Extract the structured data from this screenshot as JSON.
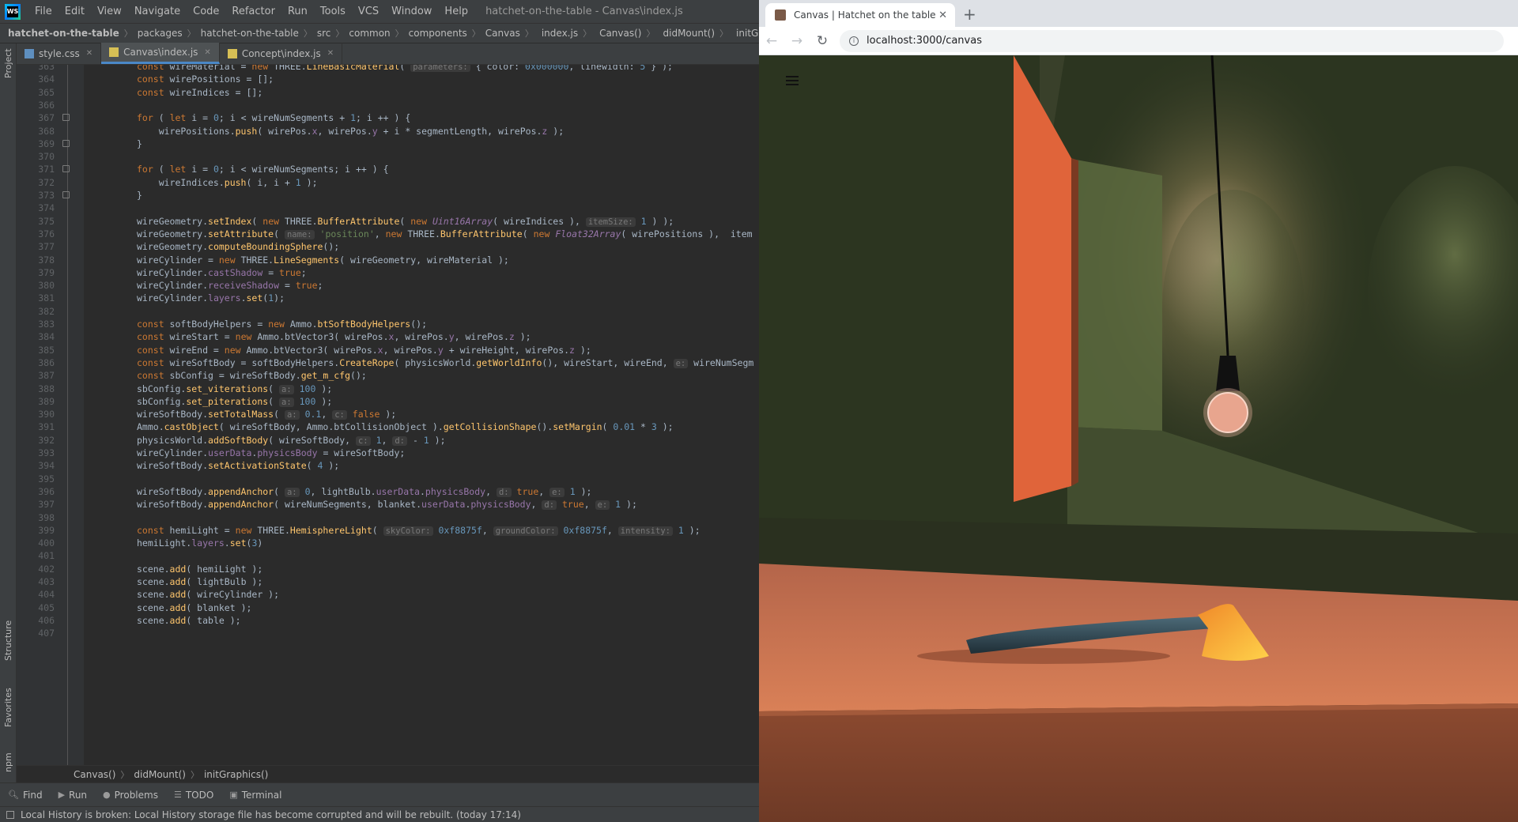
{
  "ide": {
    "logo": "WS",
    "menu": [
      "File",
      "Edit",
      "View",
      "Navigate",
      "Code",
      "Refactor",
      "Run",
      "Tools",
      "VCS",
      "Window",
      "Help"
    ],
    "window_title": "hatchet-on-the-table - Canvas\\index.js",
    "breadcrumbs": [
      "hatchet-on-the-table",
      "packages",
      "hatchet-on-the-table",
      "src",
      "common",
      "components",
      "Canvas",
      "index.js",
      "Canvas()",
      "didMount()",
      "initGraphics()"
    ],
    "left_tabs": [
      "Project",
      "Structure",
      "Favorites",
      "npm"
    ],
    "tabs": [
      {
        "label": "style.css",
        "active": false
      },
      {
        "label": "Canvas\\index.js",
        "active": true
      },
      {
        "label": "Concept\\index.js",
        "active": false
      }
    ],
    "editor_crumbs": [
      "Canvas()",
      "didMount()",
      "initGraphics()"
    ],
    "tool_windows": [
      "Find",
      "Run",
      "Problems",
      "TODO",
      "Terminal"
    ],
    "status_message": "Local History is broken: Local History storage file has become corrupted and will be rebuilt. (today 17:14)",
    "code_lines": [
      {
        "n": "363",
        "t": "const wireMaterial = new THREE.LineBasicMaterial(  parameters: { color: 0x000000, linewidth: 5 } );"
      },
      {
        "n": "364",
        "t": "const wirePositions = [];"
      },
      {
        "n": "365",
        "t": "const wireIndices = [];"
      },
      {
        "n": "366",
        "t": ""
      },
      {
        "n": "367",
        "t": "for ( let i = 0; i < wireNumSegments + 1; i ++ ) {"
      },
      {
        "n": "368",
        "t": "    wirePositions.push( wirePos.x, wirePos.y + i * segmentLength, wirePos.z );"
      },
      {
        "n": "369",
        "t": "}"
      },
      {
        "n": "370",
        "t": ""
      },
      {
        "n": "371",
        "t": "for ( let i = 0; i < wireNumSegments; i ++ ) {"
      },
      {
        "n": "372",
        "t": "    wireIndices.push( i, i + 1 );"
      },
      {
        "n": "373",
        "t": "}"
      },
      {
        "n": "374",
        "t": ""
      },
      {
        "n": "375",
        "t": "wireGeometry.setIndex( new THREE.BufferAttribute( new Uint16Array( wireIndices ),  itemSize: 1 ) );"
      },
      {
        "n": "376",
        "t": "wireGeometry.setAttribute(  name: 'position', new THREE.BufferAttribute( new Float32Array( wirePositions ),  item"
      },
      {
        "n": "377",
        "t": "wireGeometry.computeBoundingSphere();"
      },
      {
        "n": "378",
        "t": "wireCylinder = new THREE.LineSegments( wireGeometry, wireMaterial );"
      },
      {
        "n": "379",
        "t": "wireCylinder.castShadow = true;"
      },
      {
        "n": "380",
        "t": "wireCylinder.receiveShadow = true;"
      },
      {
        "n": "381",
        "t": "wireCylinder.layers.set(1);"
      },
      {
        "n": "382",
        "t": ""
      },
      {
        "n": "383",
        "t": "const softBodyHelpers = new Ammo.btSoftBodyHelpers();"
      },
      {
        "n": "384",
        "t": "const wireStart = new Ammo.btVector3( wirePos.x, wirePos.y, wirePos.z );"
      },
      {
        "n": "385",
        "t": "const wireEnd = new Ammo.btVector3( wirePos.x, wirePos.y + wireHeight, wirePos.z );"
      },
      {
        "n": "386",
        "t": "const wireSoftBody = softBodyHelpers.CreateRope( physicsWorld.getWorldInfo(), wireStart, wireEnd,  e: wireNumSegm"
      },
      {
        "n": "387",
        "t": "const sbConfig = wireSoftBody.get_m_cfg();"
      },
      {
        "n": "388",
        "t": "sbConfig.set_viterations(  a: 100 );"
      },
      {
        "n": "389",
        "t": "sbConfig.set_piterations(  a: 100 );"
      },
      {
        "n": "390",
        "t": "wireSoftBody.setTotalMass(  a: 0.1,  c: false );"
      },
      {
        "n": "391",
        "t": "Ammo.castObject( wireSoftBody, Ammo.btCollisionObject ).getCollisionShape().setMargin( 0.01 * 3 );"
      },
      {
        "n": "392",
        "t": "physicsWorld.addSoftBody( wireSoftBody,  c: 1,  d: - 1 );"
      },
      {
        "n": "393",
        "t": "wireCylinder.userData.physicsBody = wireSoftBody;"
      },
      {
        "n": "394",
        "t": "wireSoftBody.setActivationState( 4 );"
      },
      {
        "n": "395",
        "t": ""
      },
      {
        "n": "396",
        "t": "wireSoftBody.appendAnchor(  a: 0, lightBulb.userData.physicsBody,  d: true,  e: 1 );"
      },
      {
        "n": "397",
        "t": "wireSoftBody.appendAnchor( wireNumSegments, blanket.userData.physicsBody,  d: true,  e: 1 );"
      },
      {
        "n": "398",
        "t": ""
      },
      {
        "n": "399",
        "t": "const hemiLight = new THREE.HemisphereLight(  skyColor: 0xf8875f,  groundColor: 0xf8875f,  intensity: 1 );"
      },
      {
        "n": "400",
        "t": "hemiLight.layers.set(3)"
      },
      {
        "n": "401",
        "t": ""
      },
      {
        "n": "402",
        "t": "scene.add( hemiLight );"
      },
      {
        "n": "403",
        "t": "scene.add( lightBulb );"
      },
      {
        "n": "404",
        "t": "scene.add( wireCylinder );"
      },
      {
        "n": "405",
        "t": "scene.add( blanket );"
      },
      {
        "n": "406",
        "t": "scene.add( table );"
      },
      {
        "n": "407",
        "t": ""
      }
    ]
  },
  "browser": {
    "tab_title": "Canvas | Hatchet on the table",
    "url": "localhost:3000/canvas",
    "new_tab": "+",
    "close": "✕"
  },
  "colors": {
    "ide_bg": "#2b2b2b",
    "keyword": "#cc7832",
    "function": "#ffc66d",
    "number": "#6897bb",
    "string": "#6a8759",
    "property": "#9876aa",
    "scene_wall": "#2c3520",
    "scene_table": "#c66f48",
    "scene_door": "#e0643a"
  }
}
